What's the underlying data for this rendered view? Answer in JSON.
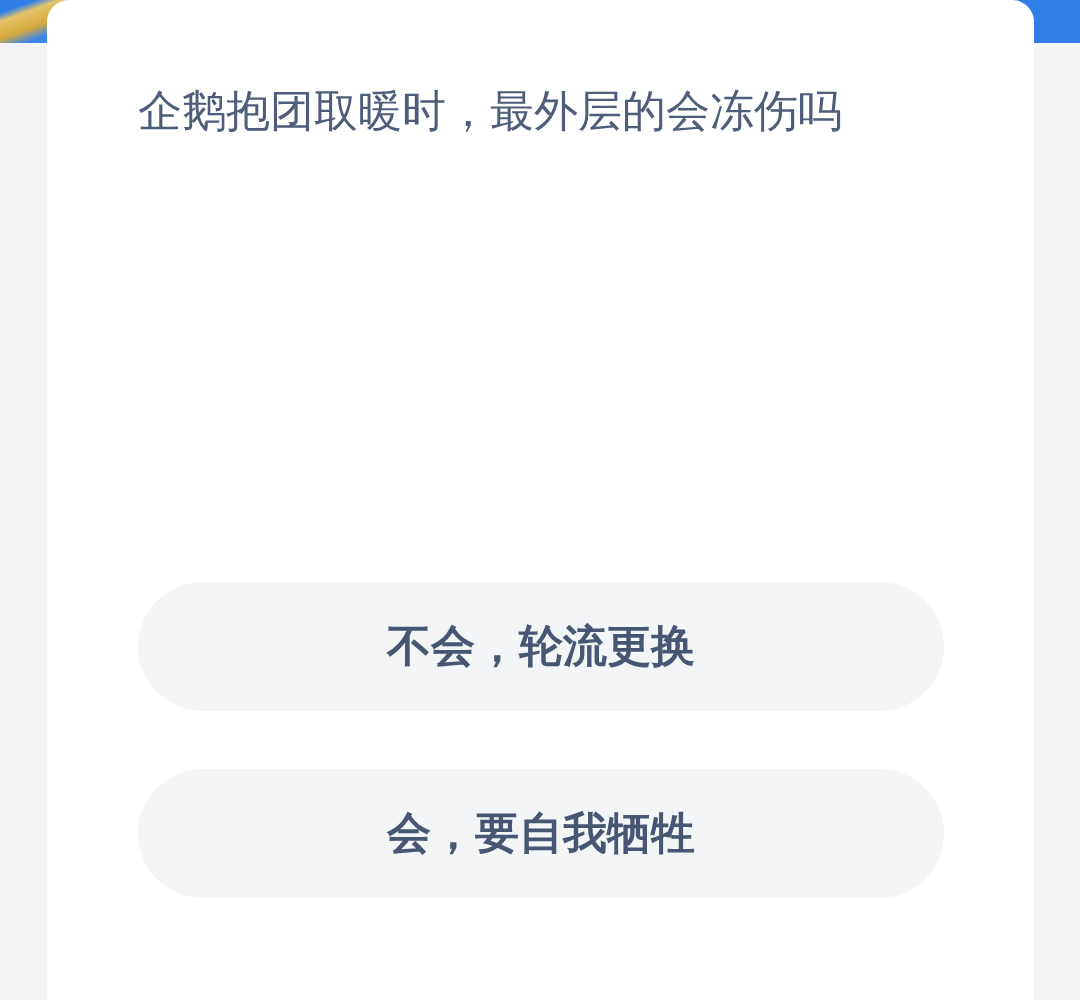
{
  "question": "企鹅抱团取暖时，最外层的会冻伤吗",
  "options": [
    {
      "label": "不会，轮流更换"
    },
    {
      "label": "会，要自我牺牲"
    }
  ]
}
